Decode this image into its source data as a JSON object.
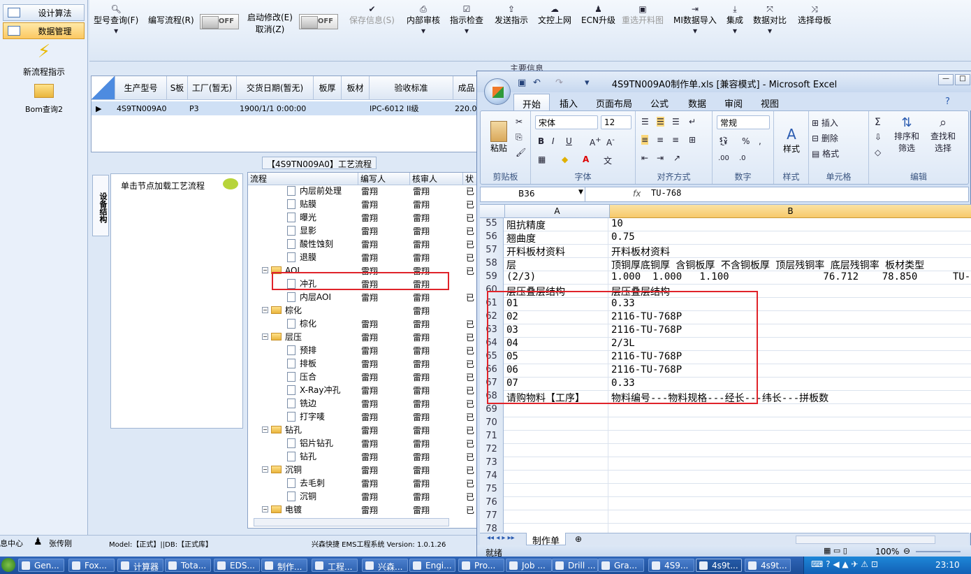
{
  "nav": {
    "items": [
      {
        "label": "设计算法"
      },
      {
        "label": "数据管理"
      }
    ],
    "buttons": [
      {
        "label": "新流程指示"
      },
      {
        "label": "Bom查询2"
      }
    ]
  },
  "toolbar": {
    "items": [
      "型号查询(F)",
      "编写流程(R)",
      "启动修改(E)",
      "取消(Z)",
      "保存信息(S)",
      "内部审核",
      "指示检查",
      "发送指示",
      "文控上网",
      "ECN升级",
      "重选开料图",
      "MI数据导入",
      "集成",
      "数据对比",
      "选择母板"
    ],
    "toggle_off": "OFF"
  },
  "main_info_label": "主要信息",
  "top_grid": {
    "headers": [
      "生产型号",
      "S板",
      "工厂(暂无)",
      "交货日期(暂无)",
      "板厚",
      "板材",
      "验收标准",
      "成品"
    ],
    "row": [
      "4S9TN009A0",
      "",
      "P3",
      "1900/1/1 0:00:00",
      "",
      "",
      "IPC-6012 II级",
      "220.0"
    ]
  },
  "flow_tab_title": "【4S9TN009A0】工艺流程",
  "equip_tab": "设备结构",
  "node_hint": "单击节点加载工艺流程",
  "tree": {
    "headers": [
      "流程",
      "编写人",
      "核审人",
      "状"
    ],
    "rows": [
      {
        "name": "内层前处理",
        "level": 2,
        "w": "雷翔",
        "r": "雷翔",
        "s": "已"
      },
      {
        "name": "贴膜",
        "level": 2,
        "w": "雷翔",
        "r": "雷翔",
        "s": "已"
      },
      {
        "name": "曝光",
        "level": 2,
        "w": "雷翔",
        "r": "雷翔",
        "s": "已"
      },
      {
        "name": "显影",
        "level": 2,
        "w": "雷翔",
        "r": "雷翔",
        "s": "已"
      },
      {
        "name": "酸性蚀刻",
        "level": 2,
        "w": "雷翔",
        "r": "雷翔",
        "s": "已"
      },
      {
        "name": "退膜",
        "level": 2,
        "w": "雷翔",
        "r": "雷翔",
        "s": "已"
      },
      {
        "name": "AOI",
        "level": 1,
        "w": "雷翔",
        "r": "雷翔",
        "s": "已"
      },
      {
        "name": "冲孔",
        "level": 2,
        "w": "雷翔",
        "r": "雷翔",
        "s": ""
      },
      {
        "name": "内层AOI",
        "level": 2,
        "w": "雷翔",
        "r": "雷翔",
        "s": "已"
      },
      {
        "name": "棕化",
        "level": 1,
        "w": "",
        "r": "雷翔",
        "s": ""
      },
      {
        "name": "棕化",
        "level": 2,
        "w": "雷翔",
        "r": "雷翔",
        "s": "已"
      },
      {
        "name": "层压",
        "level": 1,
        "w": "雷翔",
        "r": "雷翔",
        "s": "已"
      },
      {
        "name": "预排",
        "level": 2,
        "w": "雷翔",
        "r": "雷翔",
        "s": "已"
      },
      {
        "name": "排板",
        "level": 2,
        "w": "雷翔",
        "r": "雷翔",
        "s": "已"
      },
      {
        "name": "压合",
        "level": 2,
        "w": "雷翔",
        "r": "雷翔",
        "s": "已"
      },
      {
        "name": "X-Ray冲孔",
        "level": 2,
        "w": "雷翔",
        "r": "雷翔",
        "s": "已"
      },
      {
        "name": "铣边",
        "level": 2,
        "w": "雷翔",
        "r": "雷翔",
        "s": "已"
      },
      {
        "name": "打字唛",
        "level": 2,
        "w": "雷翔",
        "r": "雷翔",
        "s": "已"
      },
      {
        "name": "钻孔",
        "level": 1,
        "w": "雷翔",
        "r": "雷翔",
        "s": "已"
      },
      {
        "name": "铝片钻孔",
        "level": 2,
        "w": "雷翔",
        "r": "雷翔",
        "s": "已"
      },
      {
        "name": "钻孔",
        "level": 2,
        "w": "雷翔",
        "r": "雷翔",
        "s": "已"
      },
      {
        "name": "沉铜",
        "level": 1,
        "w": "雷翔",
        "r": "雷翔",
        "s": "已"
      },
      {
        "name": "去毛刺",
        "level": 2,
        "w": "雷翔",
        "r": "雷翔",
        "s": "已"
      },
      {
        "name": "沉铜",
        "level": 2,
        "w": "雷翔",
        "r": "雷翔",
        "s": "已"
      },
      {
        "name": "电镀",
        "level": 1,
        "w": "雷翔",
        "r": "雷翔",
        "s": "已"
      }
    ]
  },
  "status": {
    "left": "息中心",
    "user": "张传刚",
    "model": "Model:【正式】||DB:【正式库】",
    "product": "兴森快捷 EMS工程系统 Version: 1.0.1.26"
  },
  "excel": {
    "title": "4S9TN009A0制作单.xls [兼容模式] - Microsoft Excel",
    "tabs": [
      "开始",
      "插入",
      "页面布局",
      "公式",
      "数据",
      "审阅",
      "视图"
    ],
    "groups": [
      "剪贴板",
      "字体",
      "对齐方式",
      "数字",
      "样式",
      "单元格",
      "编辑"
    ],
    "paste": "粘贴",
    "font_name": "宋体",
    "font_size": "12",
    "number_format": "常规",
    "style_label": "样式",
    "insert": "插入",
    "delete": "删除",
    "format": "格式",
    "sort": "排序和",
    "filter": "筛选",
    "find": "查找和",
    "select": "选择",
    "cell_ref": "B36",
    "formula_value": "TU-768",
    "fx": "fx",
    "columns": [
      "A",
      "B"
    ],
    "rows": [
      {
        "n": "55",
        "a": "阻抗精度",
        "b": "10"
      },
      {
        "n": "56",
        "a": "翘曲度",
        "b": "0.75"
      },
      {
        "n": "57",
        "a": "开料板材资料",
        "b": "开料板材资料"
      },
      {
        "n": "58",
        "a": "层",
        "b": "顶铜厚底铜厚 含铜板厚 不含铜板厚 顶层残铜率 底层残铜率 板材类型"
      },
      {
        "n": "59",
        "a": "(2/3)",
        "b": "1.000  1.000   1.100                76.712    78.850      TU-768"
      },
      {
        "n": "60",
        "a": "层压叠层结构",
        "b": "层压叠层结构"
      },
      {
        "n": "61",
        "a": "01",
        "b": "0.33"
      },
      {
        "n": "62",
        "a": "02",
        "b": "2116-TU-768P"
      },
      {
        "n": "63",
        "a": "03",
        "b": "2116-TU-768P"
      },
      {
        "n": "64",
        "a": "04",
        "b": "2/3L"
      },
      {
        "n": "65",
        "a": "05",
        "b": "2116-TU-768P"
      },
      {
        "n": "66",
        "a": "06",
        "b": "2116-TU-768P"
      },
      {
        "n": "67",
        "a": "07",
        "b": "0.33"
      },
      {
        "n": "68",
        "a": "请购物料【工序】",
        "b": "物料编号---物料规格---经长---纬长---拼板数"
      },
      {
        "n": "69",
        "a": "",
        "b": ""
      },
      {
        "n": "70",
        "a": "",
        "b": ""
      },
      {
        "n": "71",
        "a": "",
        "b": ""
      },
      {
        "n": "72",
        "a": "",
        "b": ""
      },
      {
        "n": "73",
        "a": "",
        "b": ""
      },
      {
        "n": "74",
        "a": "",
        "b": ""
      },
      {
        "n": "75",
        "a": "",
        "b": ""
      },
      {
        "n": "76",
        "a": "",
        "b": ""
      },
      {
        "n": "77",
        "a": "",
        "b": ""
      },
      {
        "n": "78",
        "a": "",
        "b": ""
      }
    ],
    "sheet_tab": "制作单",
    "status_ready": "就绪",
    "zoom": "100%"
  },
  "taskbar": {
    "items": [
      "Gen...",
      "Fox...",
      "计算器",
      "Tota...",
      "EDS...",
      "制作...",
      "工程...",
      "兴森...",
      "Engi...",
      "Pro...",
      "Job ...",
      "Drill ...",
      "Gra...",
      "4S9...",
      "4s9t...",
      "4s9t..."
    ],
    "time": "23:10"
  },
  "colors": {
    "highlight": "#e0232a",
    "accent": "#fbc862"
  }
}
